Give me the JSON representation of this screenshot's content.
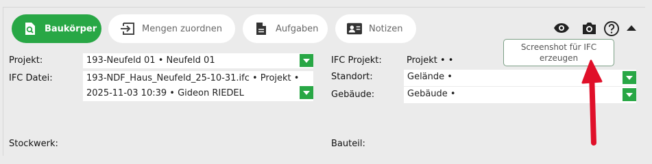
{
  "tabs": [
    {
      "label": "Baukörper",
      "icon": "search-document-icon",
      "active": true
    },
    {
      "label": "Mengen zuordnen",
      "icon": "arrow-into-box-icon"
    },
    {
      "label": "Aufgaben",
      "icon": "document-icon"
    },
    {
      "label": "Notizen",
      "icon": "contact-card-icon"
    }
  ],
  "header_icons": [
    "eye-icon",
    "camera-icon",
    "help-icon",
    "collapse-up-icon"
  ],
  "tooltip": {
    "line1": "Screenshot für IFC",
    "line2": "erzeugen"
  },
  "left": {
    "projekt_label": "Projekt:",
    "projekt_value": "193-Neufeld 01 • Neufeld 01",
    "ifc_datei_label": "IFC Datei:",
    "ifc_datei_line1": "193-NDF_Haus_Neufeld_25-10-31.ifc • Projekt •",
    "ifc_datei_line2": "2025-11-03 10:39 • Gideon RIEDEL",
    "stockwerk_label": "Stockwerk:"
  },
  "right": {
    "ifc_projekt_label": "IFC Projekt:",
    "ifc_projekt_value": "Projekt • •",
    "standort_label": "Standort:",
    "standort_value": "Gelände •",
    "gebaeude_label": "Gebäude:",
    "gebaeude_value": "Gebäude •",
    "bauteil_label": "Bauteil:"
  },
  "colors": {
    "accent": "#28a745",
    "annotation_arrow": "#e0102a"
  }
}
